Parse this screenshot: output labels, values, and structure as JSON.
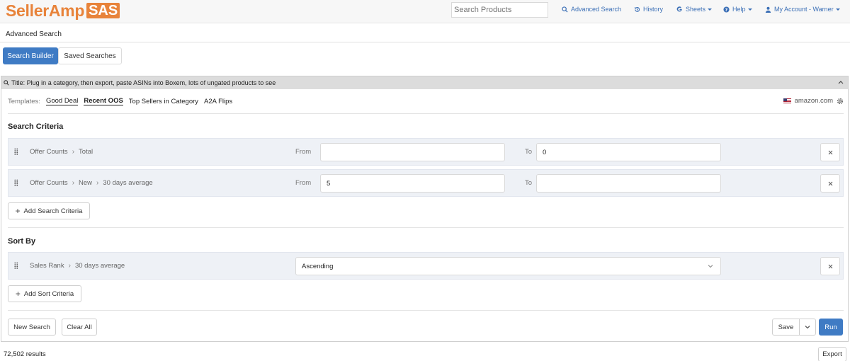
{
  "brand": {
    "name": "SellerAmp",
    "suffix": "SAS",
    "color": "#e8833a"
  },
  "topnav": {
    "search_placeholder": "Search Products",
    "links": [
      {
        "label": "Advanced Search",
        "icon": "search-icon"
      },
      {
        "label": "History",
        "icon": "history-icon"
      },
      {
        "label": "Sheets",
        "icon": "google-icon"
      },
      {
        "label": "Help",
        "icon": "question-icon"
      },
      {
        "label": "My Account - Warner",
        "icon": "user-icon"
      }
    ]
  },
  "page": {
    "breadcrumb": "Advanced Search"
  },
  "tabs": [
    {
      "label": "Search Builder",
      "active": true
    },
    {
      "label": "Saved Searches",
      "active": false
    }
  ],
  "panel": {
    "title": "Title: Plug in a category, then export, paste ASINs into Boxem, lots of ungated products to see",
    "templates_label": "Templates:",
    "templates": [
      "Good Deal",
      "Recent OOS",
      "Top Sellers in Category",
      "A2A Flips"
    ],
    "marketplace": "amazon.com",
    "search_criteria_title": "Search Criteria",
    "criteria": [
      {
        "path": [
          "Offer Counts",
          "Total"
        ],
        "from_label": "From",
        "from_value": "",
        "to_label": "To",
        "to_value": "0"
      },
      {
        "path": [
          "Offer Counts",
          "New",
          "30 days average"
        ],
        "from_label": "From",
        "from_value": "5",
        "to_label": "To",
        "to_value": ""
      }
    ],
    "add_criteria_label": "Add Search Criteria",
    "sort_title": "Sort By",
    "sort": {
      "path": [
        "Sales Rank",
        "30 days average"
      ],
      "order": "Ascending"
    },
    "add_sort_label": "Add Sort Criteria",
    "footer": {
      "new_search": "New Search",
      "clear_all": "Clear All",
      "save": "Save",
      "run": "Run"
    }
  },
  "results": {
    "count_text": "72,502 results",
    "export_label": "Export"
  },
  "colors": {
    "primary": "#3f7bc4",
    "link": "#3b6fb6",
    "row_bg": "#eef1f6"
  }
}
